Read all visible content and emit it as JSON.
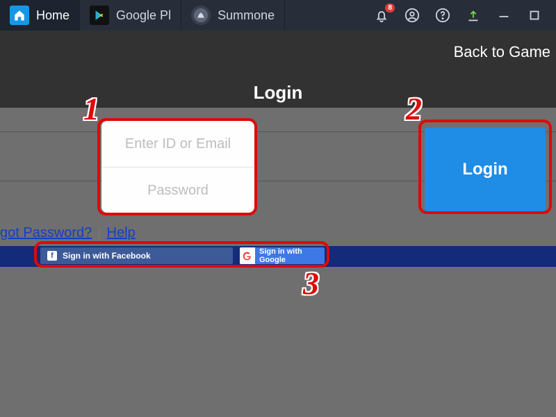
{
  "titlebar": {
    "tabs": [
      {
        "label": "Home"
      },
      {
        "label": "Google Pl"
      },
      {
        "label": "Summone"
      }
    ],
    "notification_count": "8"
  },
  "app": {
    "back_label": "Back to Game",
    "login_title": "Login",
    "id_placeholder": "Enter ID or Email",
    "pw_placeholder": "Password",
    "login_button": "Login",
    "forgot_label": "got Password?",
    "help_label": "Help",
    "fb_label": "Sign in with Facebook",
    "google_label": "Sign in with Google"
  },
  "annotations": {
    "step1": "1",
    "step2": "2",
    "step3": "3"
  }
}
